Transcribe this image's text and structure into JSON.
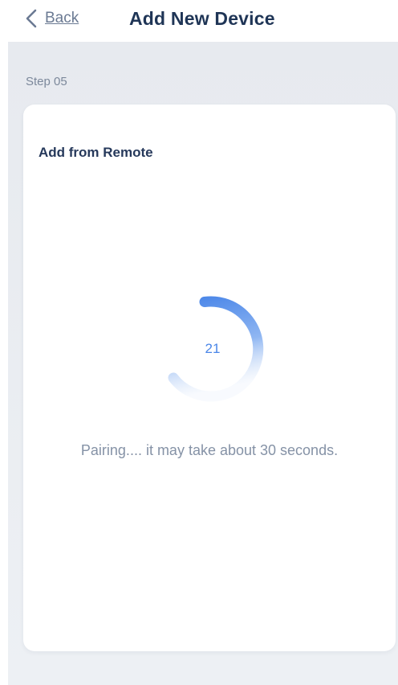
{
  "header": {
    "back_label": "Back",
    "title": "Add New Device"
  },
  "step": {
    "label": "Step 05"
  },
  "card": {
    "title": "Add from Remote",
    "countdown": "21",
    "status": "Pairing.... it may take about 30 seconds."
  },
  "colors": {
    "accent": "#4a86e8",
    "title": "#1f3556",
    "background": "#e9ecf1"
  },
  "icons": {
    "back": "chevron-left-icon",
    "spinner": "loading-ring-icon"
  }
}
